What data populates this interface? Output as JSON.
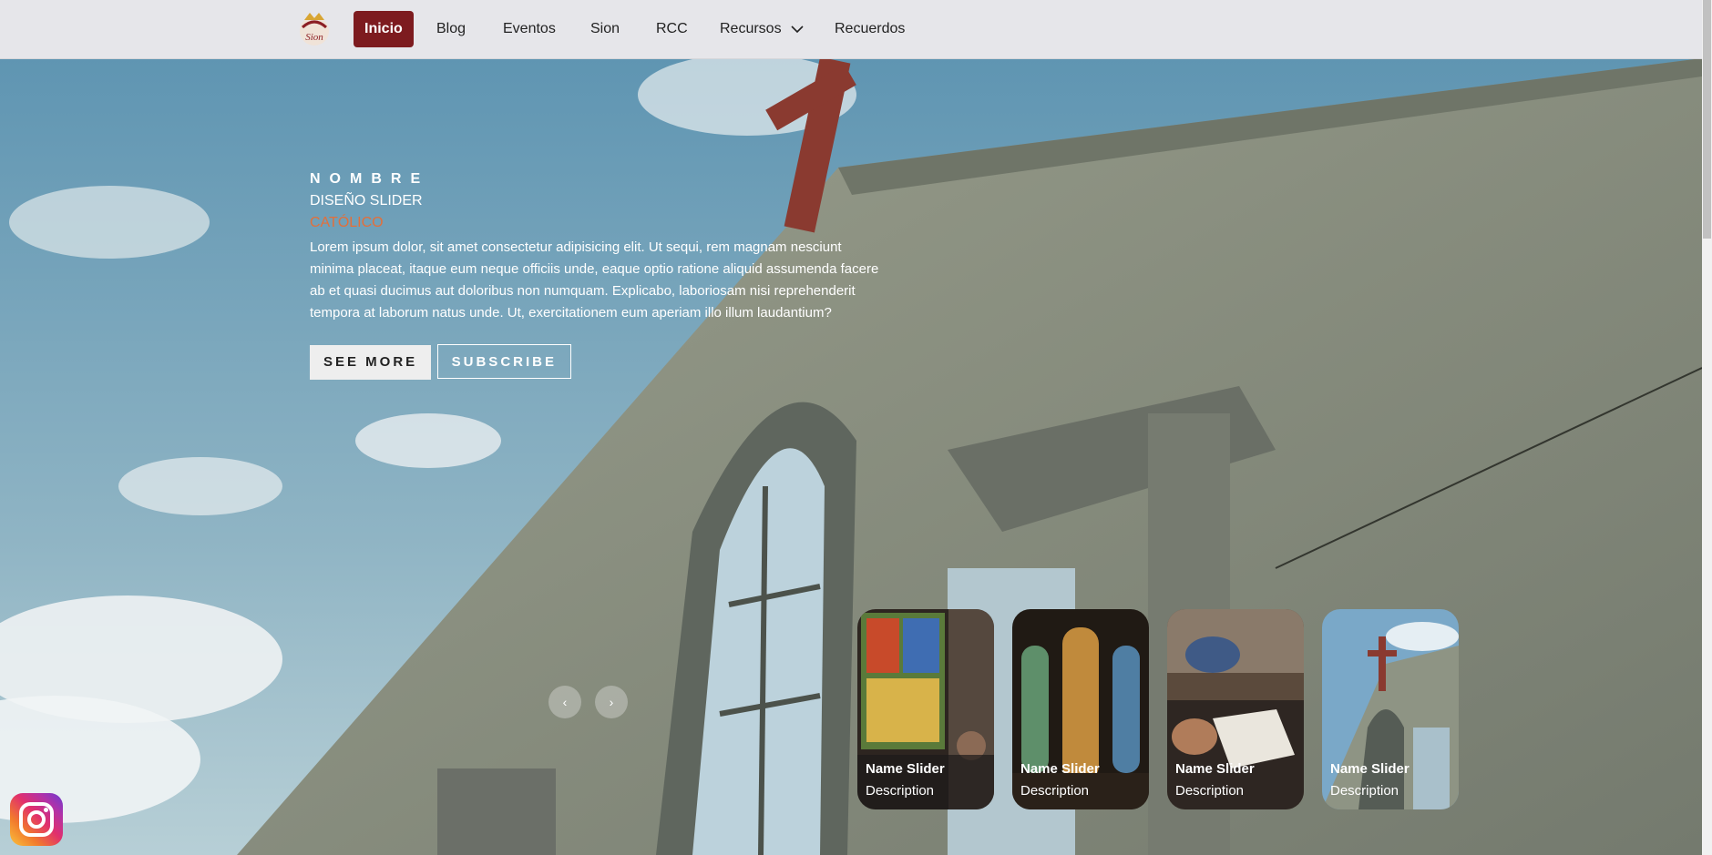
{
  "nav": {
    "items": [
      {
        "label": "Inicio",
        "active": true
      },
      {
        "label": "Blog"
      },
      {
        "label": "Eventos"
      },
      {
        "label": "Sion"
      },
      {
        "label": "RCC"
      },
      {
        "label": "Recursos",
        "dropdown": true
      },
      {
        "label": "Recuerdos"
      }
    ],
    "logo_icon": "sion-logo-icon",
    "logo_text": "Sion"
  },
  "slide": {
    "author": "NOMBRE",
    "title": "DISEÑO SLIDER",
    "topic": "CATÓLICO",
    "description": "Lorem ipsum dolor, sit amet consectetur adipisicing elit. Ut sequi, rem magnam nesciunt minima placeat, itaque eum neque officiis unde, eaque optio ratione aliquid assumenda facere ab et quasi ducimus aut doloribus non numquam. Explicabo, laboriosam nisi reprehenderit tempora at laborum natus unde. Ut, exercitationem eum aperiam illo illum laudantium?",
    "see_more": "SEE MORE",
    "subscribe": "SUBSCRIBE"
  },
  "arrows": {
    "prev": "‹",
    "next": "›"
  },
  "thumbnails": [
    {
      "name": "Name Slider",
      "desc": "Description"
    },
    {
      "name": "Name Slider",
      "desc": "Description"
    },
    {
      "name": "Name Slider",
      "desc": "Description"
    },
    {
      "name": "Name Slider",
      "desc": "Description"
    }
  ],
  "colors": {
    "accent": "#7d1b1f",
    "topic": "#e36f3a",
    "nav_bg": "#e6e6ea"
  },
  "social": {
    "icon": "instagram-icon"
  }
}
